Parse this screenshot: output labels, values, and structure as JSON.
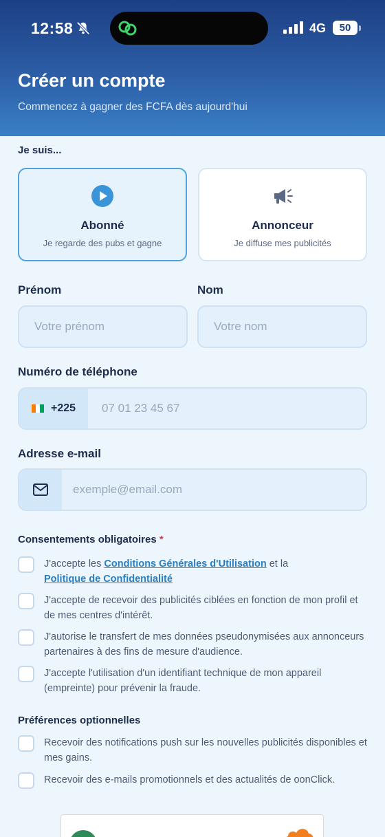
{
  "status_bar": {
    "time": "12:58",
    "network": "4G",
    "battery": "50"
  },
  "header": {
    "title": "Créer un compte",
    "subtitle": "Commencez à gagner des FCFA dès aujourd'hui"
  },
  "role": {
    "label": "Je suis...",
    "options": [
      {
        "title": "Abonné",
        "desc": "Je regarde des pubs et gagne",
        "selected": true
      },
      {
        "title": "Annonceur",
        "desc": "Je diffuse mes publicités",
        "selected": false
      }
    ]
  },
  "form": {
    "first_name": {
      "label": "Prénom",
      "placeholder": "Votre prénom"
    },
    "last_name": {
      "label": "Nom",
      "placeholder": "Votre nom"
    },
    "phone": {
      "label": "Numéro de téléphone",
      "dial_code": "+225",
      "placeholder": "07 01 23 45 67"
    },
    "email": {
      "label": "Adresse e-mail",
      "placeholder": "exemple@email.com"
    }
  },
  "consents": {
    "title": "Consentements obligatoires",
    "required_mark": "*",
    "items": [
      {
        "parts": [
          "J'accepte les ",
          "Conditions Générales d'Utilisation",
          " et la ",
          "Politique de Confidentialité"
        ]
      },
      {
        "text": "J'accepte de recevoir des publicités ciblées en fonction de mon profil et de mes centres d'intérêt."
      },
      {
        "text": "J'autorise le transfert de mes données pseudonymisées aux annonceurs partenaires à des fins de mesure d'audience."
      },
      {
        "text": "J'accepte l'utilisation d'un identifiant technique de mon appareil (empreinte) pour prévenir la fraude."
      }
    ]
  },
  "preferences": {
    "title": "Préférences optionnelles",
    "items": [
      {
        "text": "Recevoir des notifications push sur les nouvelles publicités disponibles et mes gains."
      },
      {
        "text": "Recevoir des e-mails promotionnels et des actualités de oonClick."
      }
    ]
  },
  "colors": {
    "header_top": "#1d3f84",
    "header_bottom": "#3a7fc6",
    "accent": "#4da3de",
    "link": "#2a7fc1",
    "required": "#e0394a"
  },
  "icons": {
    "role_subscriber": "play-circle-icon",
    "role_advertiser": "megaphone-icon",
    "email": "envelope-icon",
    "flag": "ivory-coast-flag-icon"
  }
}
